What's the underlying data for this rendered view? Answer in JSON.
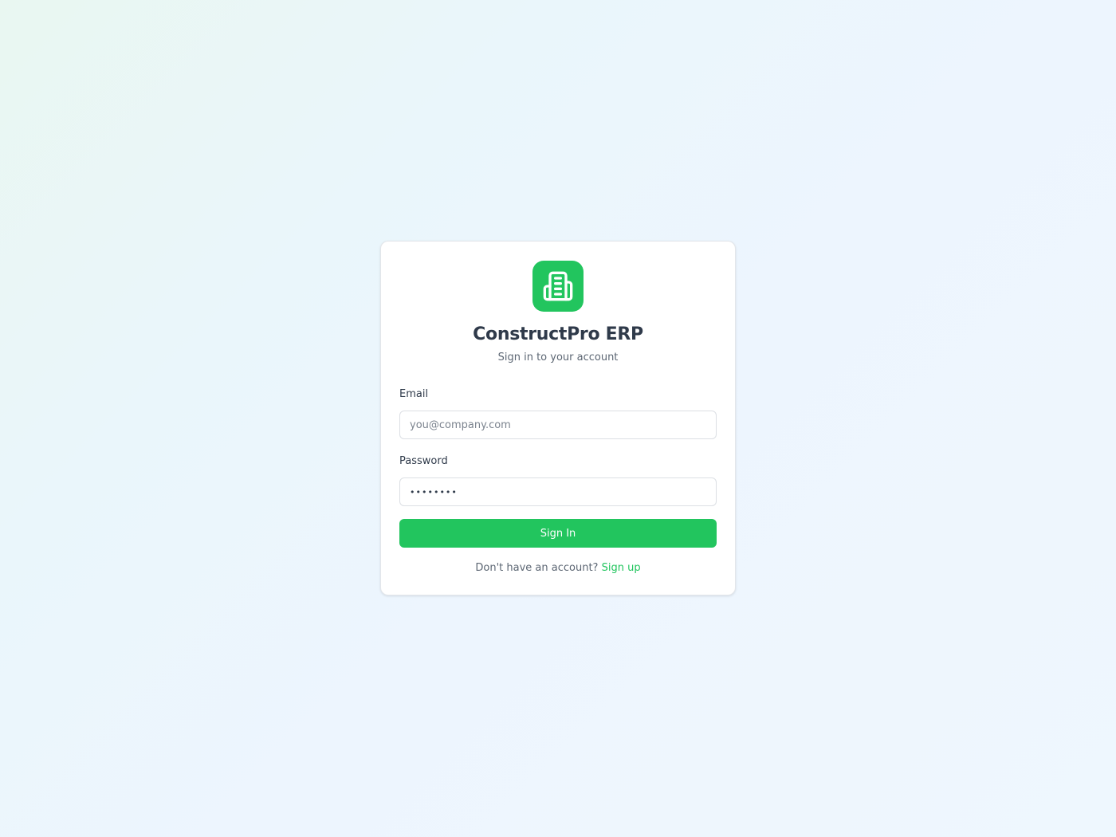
{
  "app": {
    "title": "ConstructPro ERP",
    "subtitle": "Sign in to your account",
    "logo_icon": "building-icon",
    "accent_color": "#22c55e"
  },
  "form": {
    "email_label": "Email",
    "email_placeholder": "you@company.com",
    "email_value": "",
    "password_label": "Password",
    "password_value": "••••••••",
    "submit_label": "Sign In"
  },
  "footer": {
    "prompt": "Don't have an account?",
    "signup_link": "Sign up"
  }
}
